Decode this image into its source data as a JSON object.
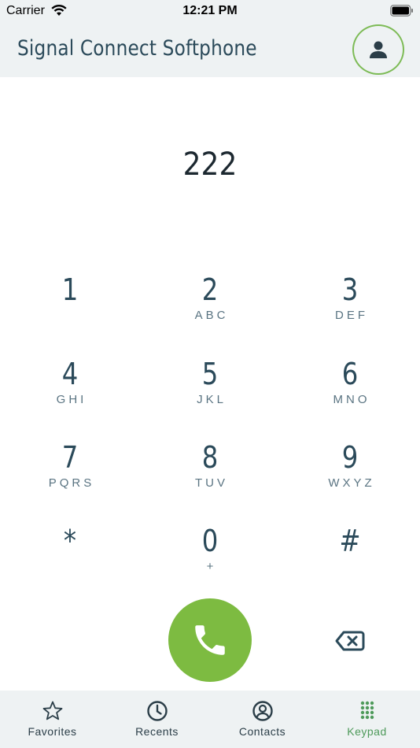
{
  "status_bar": {
    "carrier": "Carrier",
    "time": "12:21 PM"
  },
  "header": {
    "title": "Signal Connect Softphone",
    "profile_icon": "person-icon"
  },
  "dialed_number": "222",
  "keypad": [
    {
      "digit": "1",
      "letters": ""
    },
    {
      "digit": "2",
      "letters": "ABC"
    },
    {
      "digit": "3",
      "letters": "DEF"
    },
    {
      "digit": "4",
      "letters": "GHI"
    },
    {
      "digit": "5",
      "letters": "JKL"
    },
    {
      "digit": "6",
      "letters": "MNO"
    },
    {
      "digit": "7",
      "letters": "PQRS"
    },
    {
      "digit": "8",
      "letters": "TUV"
    },
    {
      "digit": "9",
      "letters": "WXYZ"
    },
    {
      "digit": "*",
      "letters": ""
    },
    {
      "digit": "0",
      "letters": "+"
    },
    {
      "digit": "#",
      "letters": ""
    }
  ],
  "actions": {
    "call_icon": "phone-icon",
    "backspace_icon": "backspace-icon"
  },
  "tabs": [
    {
      "label": "Favorites",
      "icon": "star-icon",
      "active": false
    },
    {
      "label": "Recents",
      "icon": "clock-icon",
      "active": false
    },
    {
      "label": "Contacts",
      "icon": "contact-icon",
      "active": false
    },
    {
      "label": "Keypad",
      "icon": "keypad-icon",
      "active": true
    }
  ],
  "colors": {
    "accent_green": "#7dbb41",
    "text_dark": "#2b4a5a",
    "bar_bg": "#eef2f3",
    "active_tab": "#4e9a5a"
  }
}
